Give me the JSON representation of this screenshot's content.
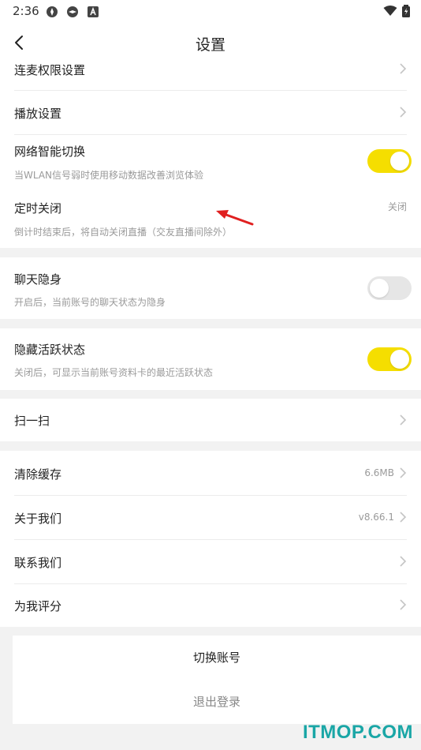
{
  "status_bar": {
    "time": "2:36"
  },
  "header": {
    "title": "设置"
  },
  "rows": {
    "mic_permission": {
      "label": "连麦权限设置"
    },
    "playback": {
      "label": "播放设置"
    },
    "network_switch": {
      "label": "网络智能切换",
      "desc": "当WLAN信号弱时使用移动数据改善浏览体验",
      "enabled": true
    },
    "timer_close": {
      "label": "定时关闭",
      "desc": "倒计时结束后，将自动关闭直播（交友直播间除外）",
      "value": "关闭"
    },
    "chat_invisible": {
      "label": "聊天隐身",
      "desc": "开启后，当前账号的聊天状态为隐身",
      "enabled": false
    },
    "hide_active": {
      "label": "隐藏活跃状态",
      "desc": "关闭后，可显示当前账号资料卡的最近活跃状态",
      "enabled": true
    },
    "scan": {
      "label": "扫一扫"
    },
    "clear_cache": {
      "label": "清除缓存",
      "value": "6.6MB"
    },
    "about": {
      "label": "关于我们",
      "value": "v8.66.1"
    },
    "contact": {
      "label": "联系我们"
    },
    "rate": {
      "label": "为我评分"
    }
  },
  "actions": {
    "switch_account": "切换账号",
    "logout": "退出登录"
  },
  "watermark": "ITMOP.COM",
  "colors": {
    "toggle_on": "#f5de00",
    "toggle_off": "#e6e6e6",
    "watermark": "#1aa6a6",
    "annotation_arrow": "#e02020"
  }
}
